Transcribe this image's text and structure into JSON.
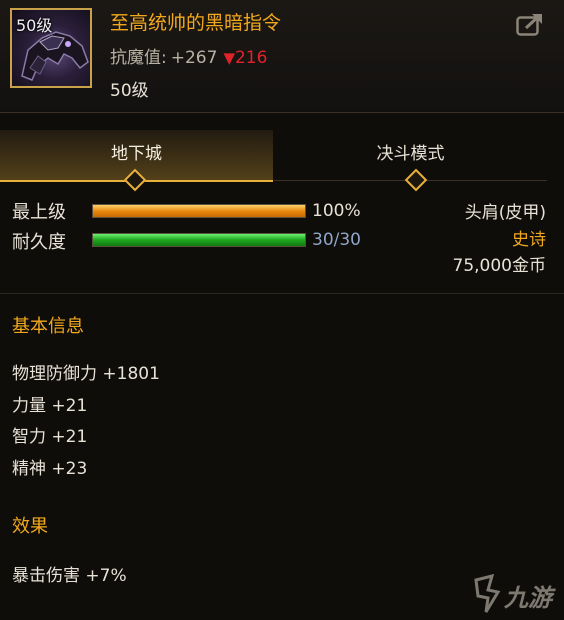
{
  "header": {
    "level_badge": "50级",
    "item_name": "至高统帅的黑暗指令",
    "resist_label": "抗魔值:",
    "resist_value": "+267",
    "resist_down_arrow": "▼",
    "resist_down_value": "216",
    "level_text": "50级"
  },
  "tabs": [
    {
      "label": "地下城",
      "active": true
    },
    {
      "label": "决斗模式",
      "active": false
    }
  ],
  "status": {
    "level_label": "最上级",
    "level_value": "100%",
    "level_fraction": 1.0,
    "durability_label": "耐久度",
    "durability_value": "30/30",
    "durability_fraction": 1.0
  },
  "info": {
    "slot": "头肩(皮甲)",
    "rarity": "史诗",
    "price": "75,000金币"
  },
  "basic": {
    "title": "基本信息",
    "stats": [
      "物理防御力 +1801",
      "力量 +21",
      "智力 +21",
      "精神 +23"
    ]
  },
  "effects": {
    "title": "效果",
    "items": [
      "暴击伤害 +7%"
    ]
  },
  "colors": {
    "item_name": "#f2a81d",
    "rarity": "#f2a81d",
    "section_title": "#f2a81d",
    "resist_down": "#e0222a",
    "durability_value": "#8fa6c8",
    "tab_accent": "#e8b03a"
  },
  "icons": {
    "share": "share-arrow-icon",
    "item": "dark-shoulder-armor-icon",
    "watermark": "jiuyou-logo"
  },
  "watermark": {
    "text": "九游"
  }
}
